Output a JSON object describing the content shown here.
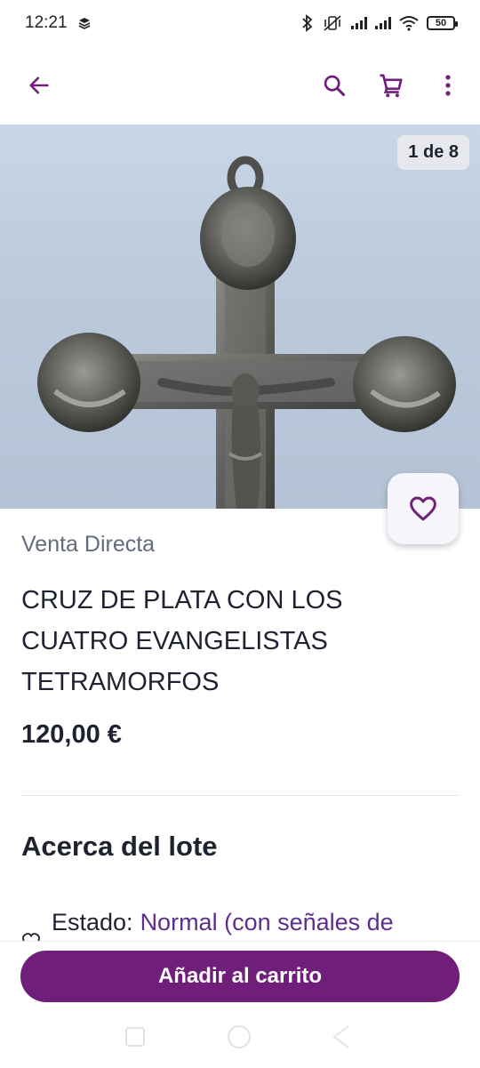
{
  "status_bar": {
    "time": "12:21",
    "battery": "50"
  },
  "app_bar": {
    "icons": [
      "back-arrow-icon",
      "search-icon",
      "cart-icon",
      "more-vertical-icon"
    ],
    "accent_color": "#6f1e79"
  },
  "gallery": {
    "counter": "1 de 8"
  },
  "product": {
    "sale_type": "Venta Directa",
    "title": "CRUZ DE PLATA CON LOS CUATRO EVANGELISTAS TETRAMORFOS",
    "price": "120,00 €"
  },
  "about": {
    "heading": "Acerca del lote",
    "state_label": "Estado:",
    "state_value": "Normal (con señales de"
  },
  "actions": {
    "add_to_cart": "Añadir al carrito"
  }
}
